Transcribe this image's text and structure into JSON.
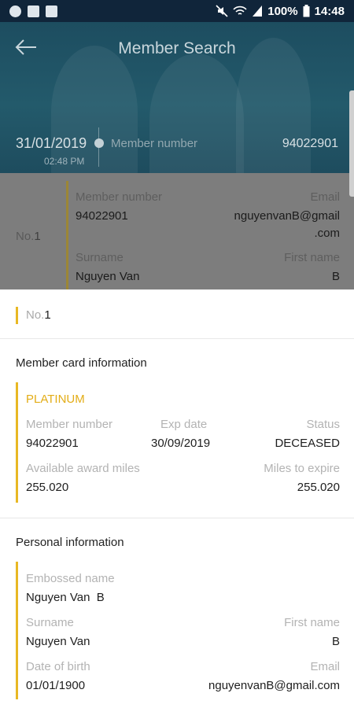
{
  "status_bar": {
    "battery": "100%",
    "time": "14:48"
  },
  "header": {
    "title": "Member Search",
    "date": "31/01/2019",
    "time": "02:48 PM",
    "member_label": "Member number",
    "member_value": "94022901"
  },
  "result_card": {
    "no_label": "No.",
    "no_value": "1",
    "member_number_label": "Member number",
    "member_number": "94022901",
    "email_label": "Email",
    "email_line1": "nguyenvanB@gmail",
    "email_line2": ".com",
    "surname_label": "Surname",
    "surname": "Nguyen Van",
    "first_name_label": "First name",
    "first_name": "B"
  },
  "sheet": {
    "no_label": "No.",
    "no_value": "1",
    "card_section": {
      "title": "Member card information",
      "tier": "PLATINUM",
      "member_number_label": "Member number",
      "member_number": "94022901",
      "exp_label": "Exp date",
      "exp_value": "30/09/2019",
      "status_label": "Status",
      "status_value": "DECEASED",
      "award_label": "Available award miles",
      "award_value": "255.020",
      "expire_label": "Miles to expire",
      "expire_value": "255.020"
    },
    "personal_section": {
      "title": "Personal information",
      "embossed_label": "Embossed name",
      "embossed_value": "Nguyen Van  B",
      "surname_label": "Surname",
      "surname_value": "Nguyen Van",
      "first_name_label": "First name",
      "first_name_value": "B",
      "dob_label": "Date of birth",
      "dob_value": "01/01/1900",
      "email_label": "Email",
      "email_value": "nguyenvanB@gmail.com"
    }
  },
  "colors": {
    "accent": "#e8b824",
    "tier": "#e3ad17",
    "header": "#235a6b"
  }
}
